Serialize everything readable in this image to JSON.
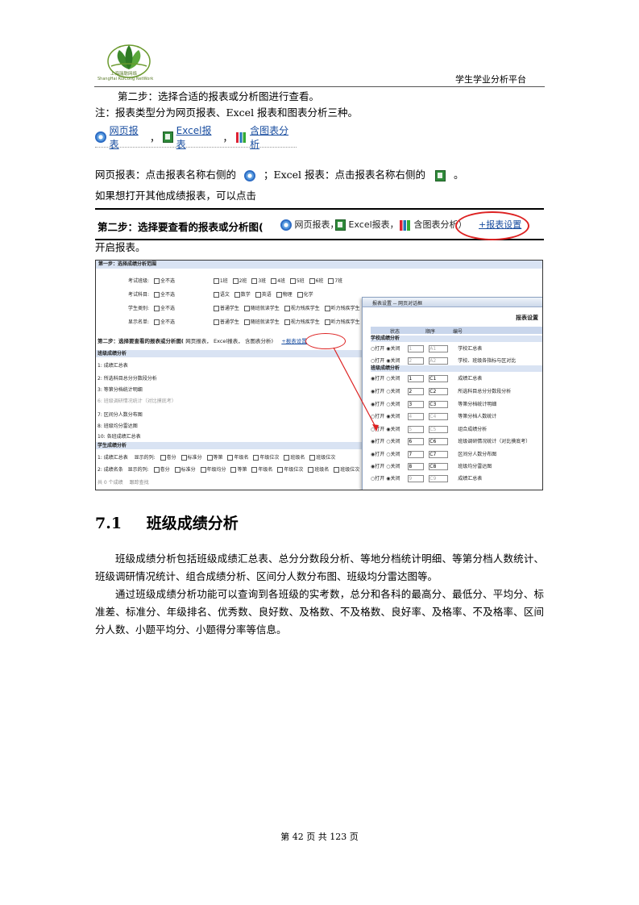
{
  "header": {
    "logo_cn": "上海瑞聪网络",
    "logo_en": "ShangHai RuiCong NetWork",
    "platform": "学生学业分析平台"
  },
  "intro": {
    "step2": "第二步：选择合适的报表或分析图进行查看。",
    "note": "注：报表类型分为网页报表、Excel 报表和图表分析三种。"
  },
  "toolbar": {
    "web": "网页报表",
    "excel": "Excel报表",
    "chart": "含图表分析"
  },
  "desc": {
    "web_part": "网页报表：点击报表名称右侧的",
    "excel_part": "；Excel 报表：点击报表名称右侧的",
    "end": "。",
    "other": "如果想打开其他成绩报表，可以点击",
    "open": "开启报表。"
  },
  "banner": {
    "title": "第二步：选择要查看的报表或分析图(",
    "web": "网页报表，",
    "excel": "Excel报表，",
    "chart": "含图表分析）",
    "link": "+报表设置"
  },
  "screenshot": {
    "step1": "第一步：选择成绩分析范围",
    "rows": [
      {
        "label": "考试班级:",
        "all": "全不选",
        "opts": [
          "1班",
          "2班",
          "3班",
          "4班",
          "5班",
          "6班",
          "7班"
        ]
      },
      {
        "label": "考试科目:",
        "all": "全不选",
        "opts": [
          "语文",
          "数学",
          "英语",
          "物理",
          "化学"
        ]
      },
      {
        "label": "学生类别:",
        "all": "全不选",
        "opts": [
          "普通学生",
          "随班就读学生",
          "视力残疾学生",
          "听力残疾学生"
        ]
      },
      {
        "label": "显示名单:",
        "all": "全不选",
        "opts": [
          "普通学生",
          "随班就读学生",
          "视力残疾学生",
          "听力残疾学生"
        ]
      }
    ],
    "step2": "第二步：选择要查看的报表或分析图(",
    "step2_web": "网页报表，",
    "step2_excel": "Excel报表，",
    "step2_chart": "含图表分析)",
    "step2_link": "+报表设置",
    "sec1": "班级成绩分析",
    "items": [
      "1: 成绩汇总表",
      "2: 所选科目总分分数段分析",
      "3: 等第分档统计明细",
      "6: 班级调研情况统计（对比摸底考）",
      "7: 区间分人数分布图",
      "8: 班级均分雷达图",
      "10: 各班成绩汇总表"
    ],
    "sec2": "学生成绩分析",
    "s_row1_a": "1: 成绩汇总表",
    "s_row1_b": "显示的列:",
    "s_row1_opts": [
      "卷分",
      "标准分",
      "等第",
      "年级名",
      "年级位次",
      "班级名",
      "班级位次"
    ],
    "s_row2_a": "2: 成绩名条",
    "s_row2_b": "显示的列:",
    "s_row2_opts": [
      "卷分",
      "标准分",
      "年级均分",
      "等第",
      "年级名",
      "年级位次",
      "班级名",
      "班级位次"
    ],
    "bottom": "共 0 个成绩",
    "bottom2": "跟踪查找",
    "dialog": {
      "title": "报表设置 -- 网页对话框",
      "heading": "报表设置",
      "cols": [
        "状态",
        "顺序",
        "编号"
      ],
      "sec_a": "学校成绩分析",
      "sec_b": "班级成绩分析",
      "open": "打开",
      "close": "关闭",
      "rows": [
        {
          "state": "close",
          "order": "1",
          "code": "A1",
          "name": "学校汇总表"
        },
        {
          "state": "close",
          "order": "2",
          "code": "A2",
          "name": "学校、班级各指标与区对比"
        },
        {
          "state": "open",
          "order": "1",
          "code": "C1",
          "name": "成绩汇总表"
        },
        {
          "state": "open",
          "order": "2",
          "code": "C2",
          "name": "所选科目总分分数段分析"
        },
        {
          "state": "open",
          "order": "3",
          "code": "C3",
          "name": "等第分档统计明细"
        },
        {
          "state": "close",
          "order": "4",
          "code": "C4",
          "name": "等第分档人数统计"
        },
        {
          "state": "close",
          "order": "5",
          "code": "C5",
          "name": "组合成绩分析"
        },
        {
          "state": "open",
          "order": "6",
          "code": "C6",
          "name": "班级调研情况统计（对比摸底考）"
        },
        {
          "state": "open",
          "order": "7",
          "code": "C7",
          "name": "区间分人数分布图"
        },
        {
          "state": "open",
          "order": "8",
          "code": "C8",
          "name": "班级均分雷达图"
        },
        {
          "state": "close",
          "order": "9",
          "code": "C9",
          "name": "成绩汇总表"
        }
      ]
    }
  },
  "section": {
    "number": "7.1",
    "title": "班级成绩分析",
    "p1": "班级成绩分析包括班级成绩汇总表、总分分数段分析、等地分档统计明细、等第分档人数统计、班级调研情况统计、组合成绩分析、区间分人数分布图、班级均分雷达图等。",
    "p2": "通过班级成绩分析功能可以查询到各班级的实考数，总分和各科的最高分、最低分、平均分、标准差、标准分、年级排名、优秀数、良好数、及格数、不及格数、良好率、及格率、不及格率、区间分人数、小题平均分、小题得分率等信息。"
  },
  "footer": {
    "page": "第 42 页 共 123 页"
  },
  "colors": {
    "accent_red": "#dd2222",
    "link_blue": "#1a4ea0",
    "section_bg": "#d9e3f3"
  }
}
